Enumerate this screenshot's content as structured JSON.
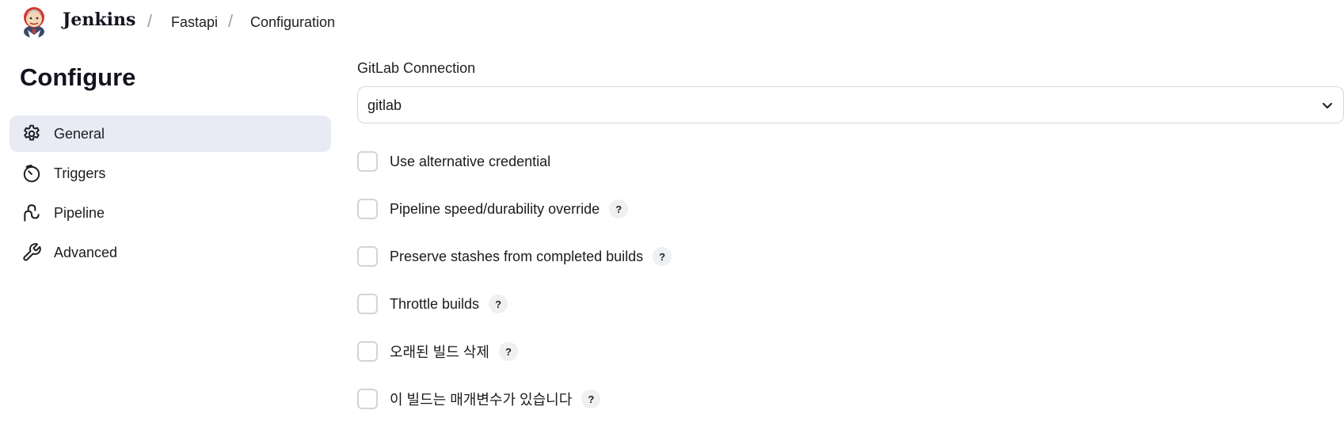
{
  "header": {
    "brand": "Jenkins",
    "breadcrumbs": [
      "Fastapi",
      "Configuration"
    ]
  },
  "sidebar": {
    "title": "Configure",
    "items": [
      {
        "label": "General",
        "icon": "gear-icon",
        "active": true
      },
      {
        "label": "Triggers",
        "icon": "timer-icon",
        "active": false
      },
      {
        "label": "Pipeline",
        "icon": "pipeline-icon",
        "active": false
      },
      {
        "label": "Advanced",
        "icon": "wrench-icon",
        "active": false
      }
    ]
  },
  "main": {
    "gitlab_connection": {
      "label": "GitLab Connection",
      "value": "gitlab"
    },
    "options": [
      {
        "label": "Use alternative credential",
        "help": "",
        "checked": false
      },
      {
        "label": "Pipeline speed/durability override",
        "help": "?",
        "checked": false
      },
      {
        "label": "Preserve stashes from completed builds",
        "help": "?",
        "checked": false
      },
      {
        "label": "Throttle builds",
        "help": "?",
        "checked": false
      },
      {
        "label": "오래된 빌드 삭제",
        "help": "?",
        "checked": false
      },
      {
        "label": "이 빌드는 매개변수가 있습니다",
        "help": "?",
        "checked": false
      }
    ]
  },
  "colors": {
    "active_nav_bg": "#e8eaf4",
    "border": "#d6d7dc",
    "help_bg": "#eef0f2"
  }
}
